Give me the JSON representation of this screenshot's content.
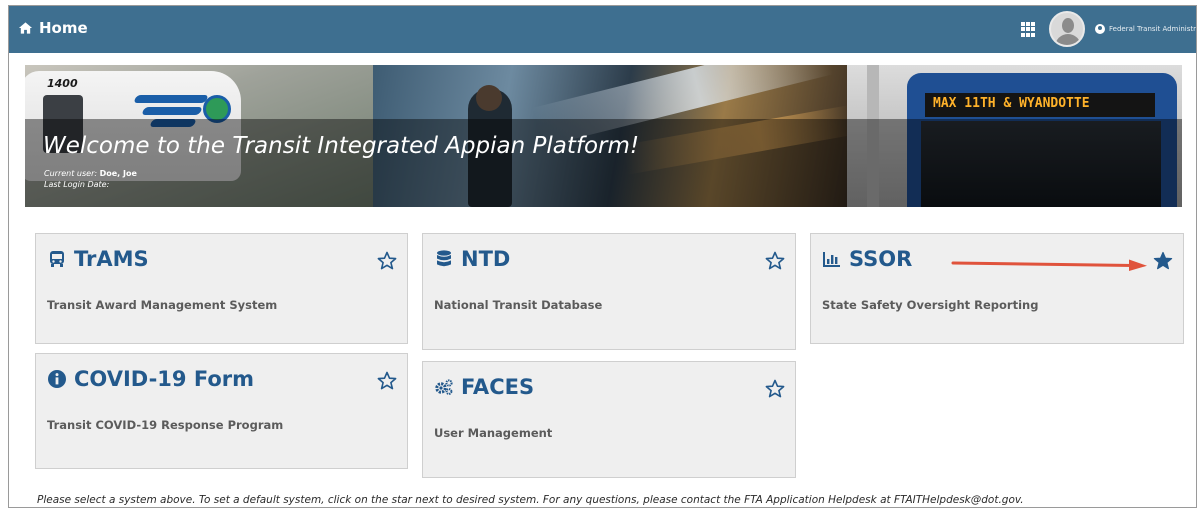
{
  "header": {
    "home_label": "Home",
    "org_label": "Federal Transit Administratio"
  },
  "banner": {
    "welcome": "Welcome to the Transit Integrated Appian Platform!",
    "current_user_label": "Current user:",
    "current_user_name": "Doe, Joe",
    "last_login_label": "Last Login Date:",
    "bus_number": "1400",
    "max_sign": "MAX 11TH & WYANDOTTE"
  },
  "tiles": [
    {
      "title": "TrAMS",
      "description": "Transit Award Management System",
      "favorite": false,
      "icon": "bus-icon"
    },
    {
      "title": "NTD",
      "description": "National Transit Database",
      "favorite": false,
      "icon": "database-icon"
    },
    {
      "title": "SSOR",
      "description": "State Safety Oversight Reporting",
      "favorite": true,
      "icon": "bar-chart-icon"
    },
    {
      "title": "COVID-19 Form",
      "description": "Transit COVID-19 Response Program",
      "favorite": false,
      "icon": "info-circle-icon"
    },
    {
      "title": "FACES",
      "description": "User Management",
      "favorite": false,
      "icon": "gears-icon"
    }
  ],
  "footer": {
    "note": "Please select a system above. To set a default system, click on the star next to desired system. For any questions, please contact the FTA Application Helpdesk at FTAITHelpdesk@dot.gov."
  },
  "colors": {
    "header_bg": "#3e6f90",
    "tile_title": "#23598c",
    "tile_bg": "#efefef",
    "arrow": "#e0533c"
  }
}
